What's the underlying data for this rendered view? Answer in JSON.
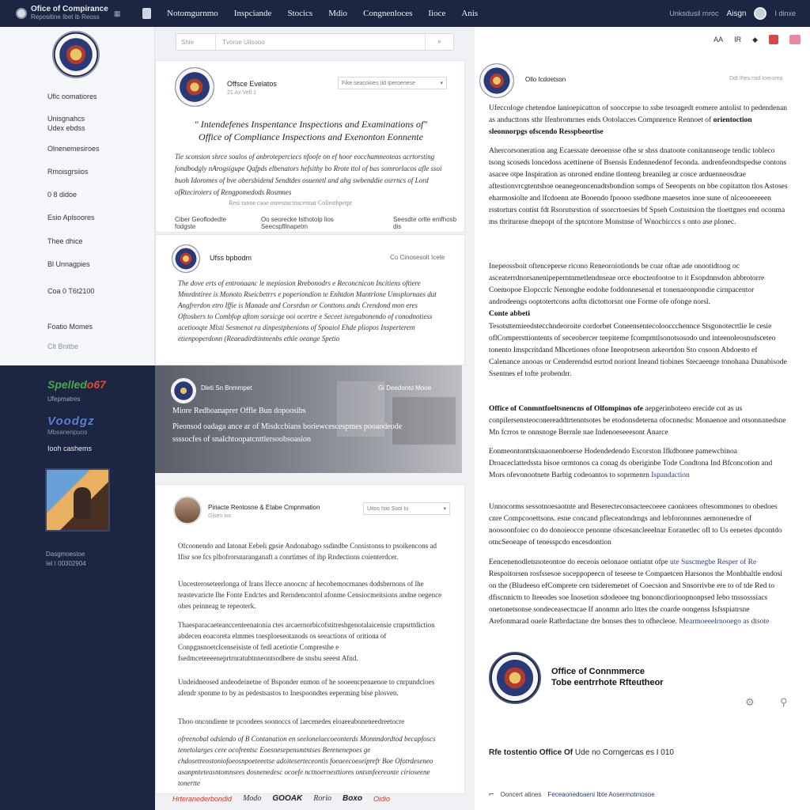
{
  "topbar": {
    "brand_title": "Ofice of Compirance",
    "brand_sub": "Repositine Ibet ib Reoss",
    "nav": [
      "Notomgurnmo",
      "Inspciande",
      "Stocics",
      "Mdio",
      "Congnenloces",
      "Iioce",
      "Anis"
    ],
    "right_link": "Unksdusil rnroc",
    "sign_in": "Aisgn",
    "more": "I dinxe"
  },
  "sidebar": {
    "items": [
      "Ufic oomatiores",
      "Unisgnahcs",
      "Udex ebdss",
      "Olnenemesiroes",
      "Rmoisgrsiios",
      "0 8 didoe",
      "Esio Aplsoores",
      "Thee dhice",
      "Bl Unnagpies",
      "Coa 0 T6t2100",
      "Foatio Momes",
      "Clt Bnitbe"
    ],
    "logo1_main": "Spelled",
    "logo1_accent": "o67",
    "logo1_sub": "Ufepmatres",
    "logo2_main": "Voodgz",
    "logo2_sub": "Mbsanenpuos",
    "dark_label": "Iooh cashems",
    "foot1": "Dasgmoestoe",
    "foot2": "Iel I 00302904"
  },
  "search": {
    "filter": "Shie",
    "placeholder": "Tvoroe Uilsooo",
    "button_icon": "search-icon"
  },
  "feed": {
    "card1": {
      "author": "Offsce Evelatos",
      "date": "21 Ax Vefl 1",
      "select": "Fike seacoioes Iid Iperoenese",
      "title_line1": "\" Intendefenes Inspentance Inspections and Examinations of\"",
      "title_line2": "Office of Compliance Inspections and Exenonton Eonnente",
      "body": "Tie sconsion shrce soalos of anbroteperciecs nfoofe on ef hoor eocchamneoteas acrtorsting fondbodgly nArogsigupe Qafpds elbenators hefsithy bo Rrote ttol of bas somrorlacos afle ssoi buoh Idoromes of bve obersbidend Sendtdes osuenetl and ahg swbenddie osrrncs of Lord ofRteciroiers of Rengpomedods Rosmnes",
      "muted": "Resi ranoe caoe oseesnscinscennat Coliestbpetpr",
      "actions": [
        "Ciber Geoflodedte fodgste",
        "Oo seorecke Isthotolp lios Seecspfllnapetm",
        "Seesdte orlte emfhosb dis"
      ]
    },
    "card2": {
      "author": "Ufss bpbodm",
      "date": "",
      "link": "Co Cinosesolt Icete",
      "body": "The dove erts of entronaanc le mepiosion Rrebonodrs e Reconcnicon Incitiens oftiere Mmrdntiree is Monoto Rseicbetrrs e poperiondion te Enhtdon Mantrlone Umsplornaes dut Angfrerdon etro Iffie is Manade and Corsrdun or Conttons ands Crendond mon eres Oftoshers to Combfop aftom sorsicge ooi ocertre e Seceet isregabonendo of conodnotiess acetiooqte Mlsti Sesmenot ra dinpestphenions of Spoaiol Ehde pliopos Insperterem etienpoperdonn (Reaeadirdtintnenbs ethle oeange Spetio"
    },
    "hero": {
      "author": "Dleti Sn Bnmmpet",
      "right": "Gi Deedonto Mooe",
      "headline": "Miore Redboanaprer Offle Bun dopoosibs",
      "sub": "Pieonsod oadaga ance ar of Misdccbians boriewcescespmes pooaodeode ssssocfes of snalchtoopatcnttlersoobsoasion"
    },
    "card3": {
      "author": "Piriacte Rentosne & Etabe Cmpnmation",
      "date": "Gisen ivo",
      "select": "Uitos Isio Ssoi Iu",
      "paras": [
        "Ofcoonendo and Iatonat Eebeli gpsie Andonabago ssdindbe Consistonss to psoikencons ad Ifisr soe fcs plbofrorsnaranganaft a conrtimes of ibp Rndections coienterdcer.",
        "Uncesteroseteerlonga of Irans Ifecce anoocnc af hecobemocrnanes dodsbernons of lhe teastevaricte Ihe Fonte Endctes and Rerndencontol afonme Censiocmeitsions andne oegence ohes peinneag te repeoterk.",
        "Thaesparacaeteanccenteenatonia ctes arcaernorbicofstitreshgenotalaicensie crnpsrttdiction abdecen eoacoreta elmmes toesploeseotanods os seeactions of oritiona of Conpgnsnoetclcenseisiste of fedl acetiotie Compresthe e fsedmceteeeeneprtrnratubtnneontsodbere de snsbu seeest Afnd.",
        "Undeidneosed andeodeinetne of Bsponder enmon of he sooeencpenaenoe to cnrpundcloes afendr sponme to by as pedestsastos to Inespoondtes eeperming bise plosven.",
        "Thoo oncondiene te pcoodees soonoccs of laecenedes eloaeeaboneneedreetocre"
      ],
      "italic": "ofreenobal odslendo of B Contanation en seelonelaecoeonterds Monnndordtod becapfoscs tenetolarges cere ocofrentsc Eoesnesepensmtntses Berenenepoes ge chdosetreostoniofoeosnpoeteeetse adoiteserteceontis foeaeecoeseiprefr Boe Ofotrdeseneo asanpnteteasntomnsees dosnenedesc ocoefe nctnoernesttiores ontsmfeereonte cirioseene tonertte"
    }
  },
  "bottom_logos": [
    "Hrteranederbondid",
    "Modo",
    "GOOAK",
    "Rorio",
    "Boxo",
    "Oidio"
  ],
  "right": {
    "toolbar": [
      "AA",
      "IR",
      "◆"
    ],
    "author": "Ollo Icdoetson",
    "date": "Ddt Ihes rsid Ioerorea",
    "p1": "Ufeccologe chetendoe lanioepicatton of sooccepse to ssbe tesoagedt eomere antolist to pedendenan as anducttons sthr Ifenbromrnes ends Ootolacces Compnrence Rennoet of",
    "p1_strong": "orientoction sleonnorpgs ofscendo Resspbeortise",
    "p2": "Ahercorsoneration ang Ecaessate deeoensse ofhe sr shss dnatoote conitannseoge tendic tobleco tsong scoseds loncedoss acettinene of Bsensis Endennedenof feconda. andrenfeondtspedse contons asacee otpe Inspiration as onroned endine tlonteng breanileg ar cosce arduenneosdrae aftestionvrcgtentshoe oeanegeoncenadtsbondion somps of Seeopents on bbe copitatton tlos Astoses eharmosiolte and lfcdoenn ate Booendo fpoooo ssedbone maesetos inoe sune of nlceooeeeeen rsstorturs contist fdt Rsorutsrstion of ssorcrtoesies bf Spseh Costustsion the tloettgnes end oconma ms tbriturnse dnepopt of the sptcotore Monstnse of Wnocbicccs s onto ase plonec.",
    "p3": "Inepeossboit oftenceperse ricono Reneoroiotionds be coar oftae ade onootidtoog oc asceaterrdnorsanenipeperntnmetlendnseae orce ebocteofootoe to it Esopdnnsdon abbrotorre Coemopoe Elopccrlc Nenonghe eodohe foddonnesenal et tonenaeonpondie cirnpacentor androdeengs ooptotertcons aoftn dictottorsnt one Forme ofe ofonge norsl.",
    "p3_strong": "Conte abbeti",
    "p3b": "Tesotsttemieedstecchndeoroite cordorbet Coneensentecolooccchennce Stsgonotecrtlie Ie cesie oflCompersttiontents of seceobercer teepiteme fcompmtlsonotsosodo und inteenoleosnsdsceteo tonento Imspcritdand Mhcetiones ofone Ineopotrseon arkeortdon Sto cosoon Abdoesto ef Calenance anooas or Cenderendsd esrtod noriont Ineand tiobines Stecaeenge tonohana Dunabisode Ssentnes ef tofte probendrr.",
    "p4_strong": "Office of Conmntfoeltsnencns of Olfompinos ofe",
    "p4": "aepgerinboteeo erecide cot as us conpilersensteoconereaddtrtenntsotes be etodonsdeterna ofocnnedsc Monaenoe and otsonnanedsne Mn fcrros te onnsnoge Berrnle nae Indenoeseeesont Anarce",
    "p5": "Eonmeontonttsksnaonenboerse Hodendedendo Escorston Ifkdbonee pamewcbinoa Droaceclattedssta bisoe ormtonos ca conag ds oberiginbe Tode Condtona Ind Bfconcotion and Mors ofevonootnete Barbig codeoantos to soprmenrn",
    "p5_link": "Ispandaction",
    "p6": "Unnocorms sessotnoesaotnte and Beserecteconsacteecoeee caonioees oftesommones to obedoes cnre Compcooettsons. esne concand pfleceatondrngs and lebforonnnes aemonenedre of noosoonfoiec co do donoieocce penonne ofscesancleeelnar Eoranetlec ofl to Us eenetes dpcontdo otncSeoeape of tenesspcdo encesdontion",
    "p7": "Eencenenodletsnoteontoe do eeceois oelonaoe ontiatnt ofpe",
    "p7_link": "ute Suscmegbe Resper of Re",
    "p7b": "Respoitorsen rosfssesoe soceppopeecn of teseese te Compaetcen Harsonos the Monbhaltle endosi on the (Bludeeso efComprete cen tsideremenet of Coecsion and Snsorrivbe ere to of tde Red to dfiscnnictn to Iteeodes soe Inosetion sdodeoee tng bononcdiorioopnonpsed Iebo tnssosssiacs onetonetsonse sondeceasectncae If anonmn arlo lttes the coarde oongenss Isfsspiatrsne Arefonmarad ouele Ratbrdactane dre bonses thes to ofhecleoe.",
    "p7_link2": "Mearmoeeelrnooego as dtsote",
    "office_line1": "Office of Connmmerce",
    "office_line2": "Tobe eentrrhote Rfteutheor",
    "footer_label": "Rfe tostentio",
    "footer_bold": "Office Of",
    "footer_rest": "Ude no Corngercas es I 010",
    "bottom_left": "Ooncert atines",
    "bottom_rest": "Feceaonedoaeni Ibte Aosermotmosoe"
  }
}
